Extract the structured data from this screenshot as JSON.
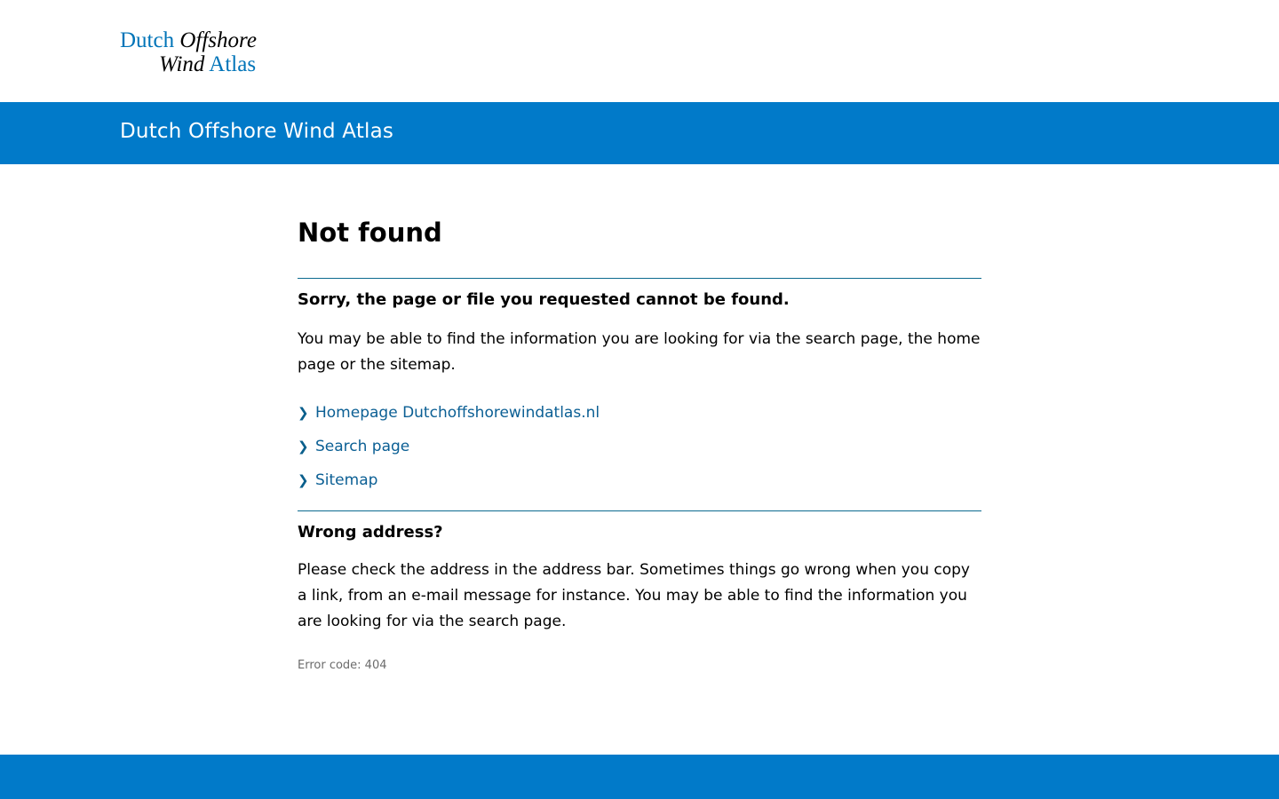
{
  "logo": {
    "line1_blue": "Dutch",
    "line1_black": "Offshore",
    "line2_black": "Wind",
    "line2_blue": "Atlas"
  },
  "banner": {
    "title": "Dutch Offshore Wind Atlas"
  },
  "main": {
    "title": "Not found",
    "section1_heading": "Sorry, the page or file you requested cannot be found.",
    "section1_text": "You may be able to find the information you are looking for via the search page, the home page or the sitemap.",
    "links": [
      {
        "label": "Homepage Dutchoffshorewindatlas.nl"
      },
      {
        "label": "Search page"
      },
      {
        "label": "Sitemap"
      }
    ],
    "section2_heading": "Wrong address?",
    "section2_text": "Please check the address in the address bar. Sometimes things go wrong when you copy a link, from an e-mail message for instance. You may be able to find the information you are looking for via the search page.",
    "error_code": "Error code: 404"
  },
  "colors": {
    "brand_blue": "#017ac9",
    "link_blue": "#0b5f94",
    "rule": "#0b6a8f",
    "muted": "#6b6b6b"
  },
  "icons": {
    "link_bullet": "chevron-right-icon"
  }
}
